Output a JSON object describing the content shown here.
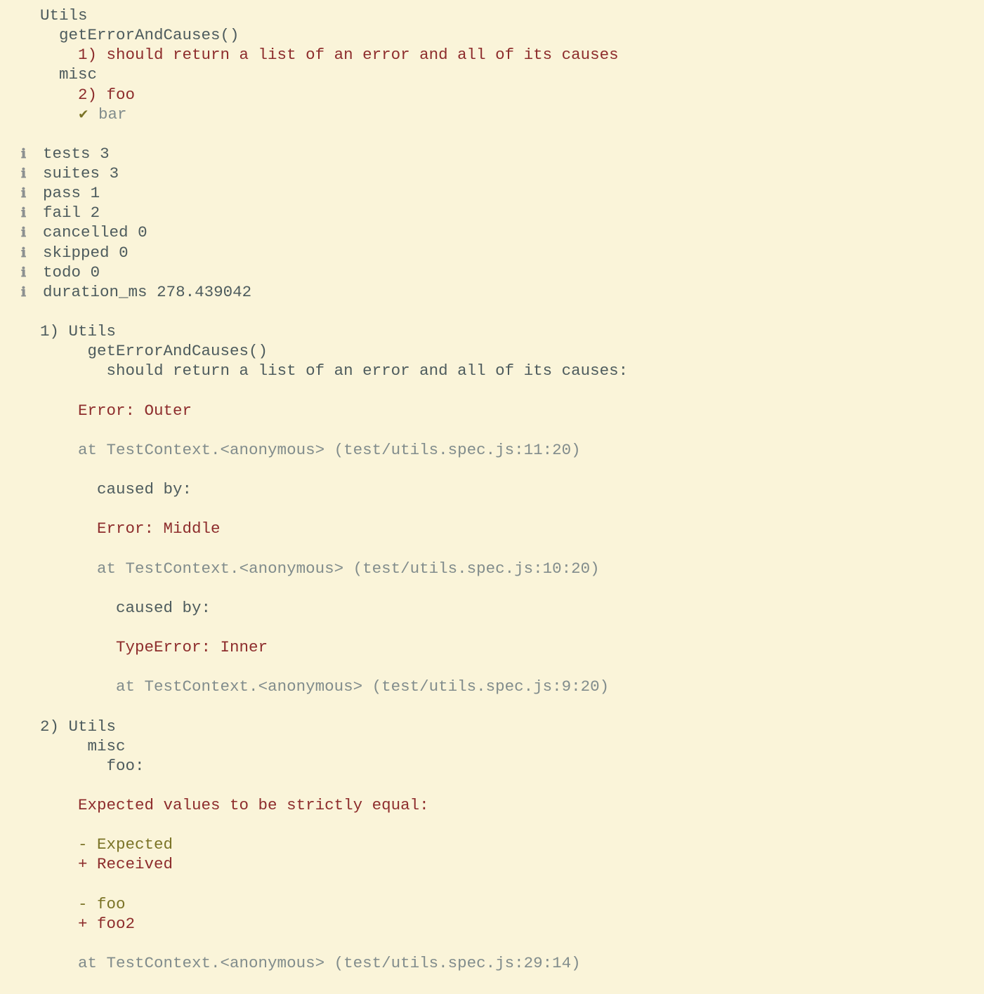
{
  "tree": {
    "suite1": "Utils",
    "group1": "getErrorAndCauses()",
    "fail1": "1) should return a list of an error and all of its causes",
    "group2": "misc",
    "fail2": "2) foo",
    "pass1_mark": "✔",
    "pass1": "bar"
  },
  "stats": {
    "icon": "ℹ",
    "tests_lbl": "tests",
    "tests_val": "3",
    "suites_lbl": "suites",
    "suites_val": "3",
    "pass_lbl": "pass",
    "pass_val": "1",
    "fail_lbl": "fail",
    "fail_val": "2",
    "cancelled_lbl": "cancelled",
    "cancelled_val": "0",
    "skipped_lbl": "skipped",
    "skipped_val": "0",
    "todo_lbl": "todo",
    "todo_val": "0",
    "duration_lbl": "duration_ms",
    "duration_val": "278.439042"
  },
  "failures": {
    "f1": {
      "num": "1)",
      "path1": "Utils",
      "path2": "getErrorAndCauses()",
      "path3": "should return a list of an error and all of its causes:",
      "err1": "Error: Outer",
      "stack1": "at TestContext.<anonymous> (test/utils.spec.js:11:20)",
      "cause_lbl": "caused by:",
      "err2": "Error: Middle",
      "stack2": "at TestContext.<anonymous> (test/utils.spec.js:10:20)",
      "err3": "TypeError: Inner",
      "stack3": "at TestContext.<anonymous> (test/utils.spec.js:9:20)"
    },
    "f2": {
      "num": "2)",
      "path1": "Utils",
      "path2": "misc",
      "path3": "foo:",
      "msg": "Expected values to be strictly equal:",
      "exp_hdr": "- Expected",
      "rec_hdr": "+ Received",
      "exp_val": "- foo",
      "rec_val": "+ foo2",
      "stack": "at TestContext.<anonymous> (test/utils.spec.js:29:14)"
    }
  }
}
